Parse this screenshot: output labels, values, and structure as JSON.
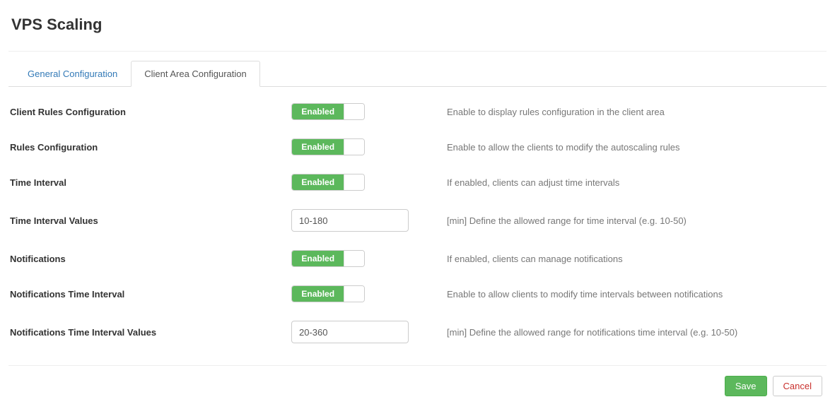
{
  "page": {
    "title": "VPS Scaling"
  },
  "tabs": {
    "general": "General Configuration",
    "client_area": "Client Area Configuration"
  },
  "toggle": {
    "enabled_label": "Enabled"
  },
  "rows": {
    "client_rules": {
      "label": "Client Rules Configuration",
      "desc": "Enable to display rules configuration in the client area"
    },
    "rules_config": {
      "label": "Rules Configuration",
      "desc": "Enable to allow the clients to modify the autoscaling rules"
    },
    "time_interval": {
      "label": "Time Interval",
      "desc": "If enabled, clients can adjust time intervals"
    },
    "time_interval_values": {
      "label": "Time Interval Values",
      "value": "10-180",
      "desc": "[min] Define the allowed range for time interval (e.g. 10-50)"
    },
    "notifications": {
      "label": "Notifications",
      "desc": "If enabled, clients can manage notifications"
    },
    "notifications_time_interval": {
      "label": "Notifications Time Interval",
      "desc": "Enable to allow clients to modify time intervals between notifications"
    },
    "notifications_time_interval_values": {
      "label": "Notifications Time Interval Values",
      "value": "20-360",
      "desc": "[min] Define the allowed range for notifications time interval (e.g. 10-50)"
    }
  },
  "footer": {
    "save": "Save",
    "cancel": "Cancel"
  }
}
